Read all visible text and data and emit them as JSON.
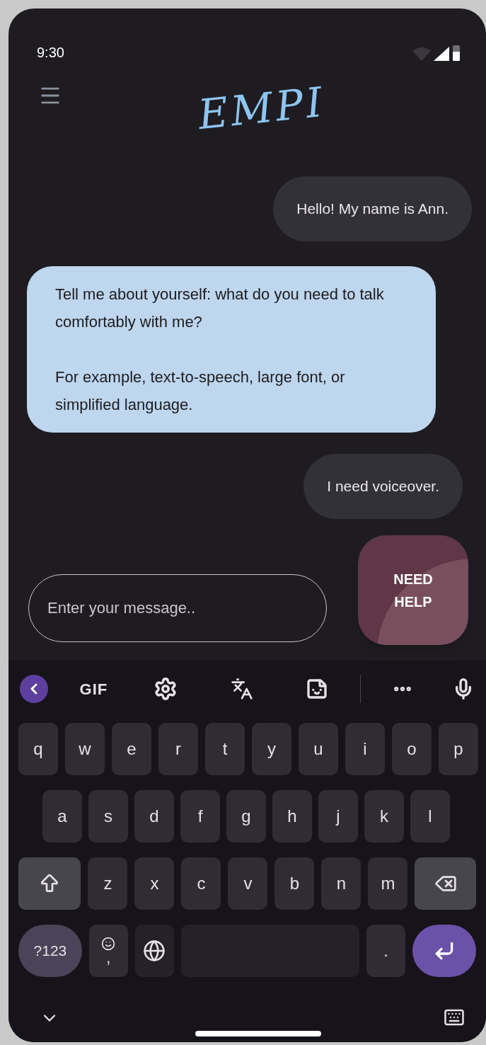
{
  "status_bar": {
    "time": "9:30"
  },
  "header": {
    "logo": "EMPI"
  },
  "messages": [
    {
      "kind": "user",
      "paragraphs": [
        "Hello! My name is Ann."
      ]
    },
    {
      "kind": "bot",
      "paragraphs": [
        "Tell me about yourself: what do you need to talk comfortably with me?",
        "For example, text-to-speech, large font, or simplified language."
      ]
    },
    {
      "kind": "user",
      "paragraphs": [
        "I need voiceover."
      ]
    }
  ],
  "composer": {
    "placeholder": "Enter your message.."
  },
  "help_button": {
    "label": "NEED HELP"
  },
  "keyboard": {
    "gif_label": "GIF",
    "rows": [
      [
        "q",
        "w",
        "e",
        "r",
        "t",
        "y",
        "u",
        "i",
        "o",
        "p"
      ],
      [
        "a",
        "s",
        "d",
        "f",
        "g",
        "h",
        "j",
        "k",
        "l"
      ],
      [
        "z",
        "x",
        "c",
        "v",
        "b",
        "n",
        "m"
      ]
    ],
    "symbols_key": "?123",
    "comma_key": ",",
    "period_key": "."
  }
}
